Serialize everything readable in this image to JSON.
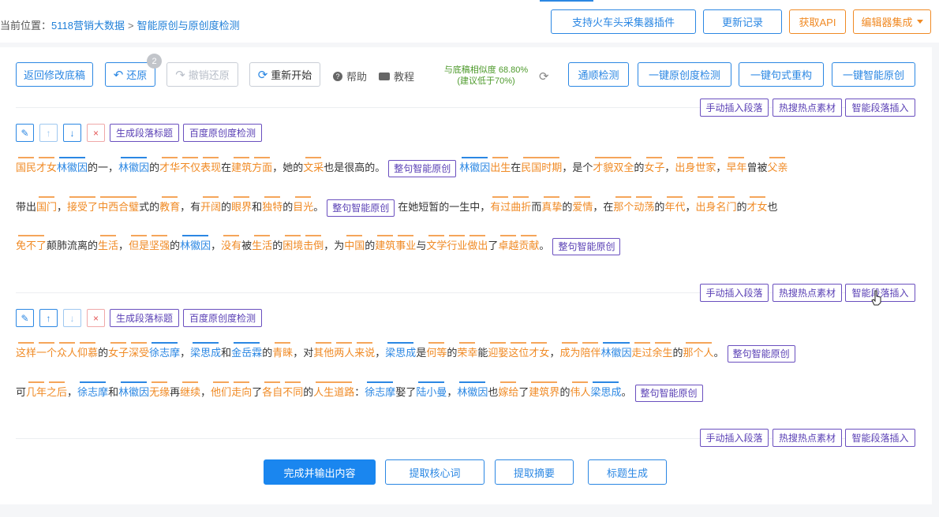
{
  "breadcrumb": {
    "prefix": "当前位置：",
    "items": [
      "5118营销大数据",
      "智能原创与原创度检测"
    ],
    "separator": ">"
  },
  "header_buttons": [
    "支持火车头采集器插件",
    "更新记录",
    "获取API",
    "编辑器集成"
  ],
  "toolbar": {
    "back": "返回修改底稿",
    "undo": "还原",
    "undo_count": "2",
    "redo": "撤销还原",
    "restart": "重新开始",
    "help": "帮助",
    "tutorial": "教程",
    "similarity_line1": "与底稿相似度 68.80%",
    "similarity_line2": "(建议低于70%)",
    "actions": [
      "通顺检测",
      "一键原创度检测",
      "一键句式重构",
      "一键智能原创"
    ]
  },
  "insert_buttons": [
    "手动插入段落",
    "热搜热点素材",
    "智能段落插入"
  ],
  "para_tools": {
    "edit": "✎",
    "up": "↑",
    "down": "↓",
    "delete": "×",
    "gen_title": "生成段落标题",
    "baidu_check": "百度原创度检测"
  },
  "sentence_button": "整句智能原创",
  "paragraph1": {
    "line1": [
      [
        "国民",
        "o"
      ],
      [
        "才女",
        "o"
      ],
      [
        "林徽因",
        "b"
      ],
      [
        "的一，",
        ""
      ],
      [
        "林徽因",
        "b"
      ],
      [
        "的",
        ""
      ],
      [
        "才华",
        "o"
      ],
      [
        "不仅",
        "o"
      ],
      [
        "表现",
        "o"
      ],
      [
        "在",
        ""
      ],
      [
        "建筑",
        "o"
      ],
      [
        "方面",
        "o"
      ],
      [
        "，她的",
        ""
      ],
      [
        "文采",
        "o"
      ],
      [
        "也是很高的。",
        ""
      ],
      [
        "#BTN#",
        ""
      ],
      [
        "林徽因",
        "b"
      ],
      [
        "出生",
        "o"
      ],
      [
        "在",
        ""
      ],
      [
        "民国时期",
        "o"
      ],
      [
        "，是个",
        ""
      ],
      [
        "才貌双全",
        "o"
      ],
      [
        "的",
        ""
      ],
      [
        "女子",
        "o"
      ],
      [
        "，",
        ""
      ],
      [
        "出身",
        "o"
      ],
      [
        "世家",
        "o"
      ],
      [
        "，",
        ""
      ],
      [
        "早年",
        "o"
      ],
      [
        "曾被",
        ""
      ],
      [
        "父亲",
        "o"
      ]
    ],
    "line2": [
      [
        "带出",
        ""
      ],
      [
        "国门",
        "o"
      ],
      [
        "，",
        ""
      ],
      [
        "接受了",
        "o"
      ],
      [
        "中西合璧",
        "o"
      ],
      [
        "式的",
        ""
      ],
      [
        "教育",
        "o"
      ],
      [
        "，有",
        ""
      ],
      [
        "开阔",
        "o"
      ],
      [
        "的",
        ""
      ],
      [
        "眼界",
        "o"
      ],
      [
        "和",
        ""
      ],
      [
        "独特",
        "o"
      ],
      [
        "的",
        ""
      ],
      [
        "目光",
        "o"
      ],
      [
        "。",
        ""
      ],
      [
        "#BTN#",
        ""
      ],
      [
        "在她短暂的一生中，",
        ""
      ],
      [
        "有过",
        "o"
      ],
      [
        "曲折",
        "o"
      ],
      [
        "而",
        ""
      ],
      [
        "真挚",
        "o"
      ],
      [
        "的",
        ""
      ],
      [
        "爱情",
        "o"
      ],
      [
        "，在",
        ""
      ],
      [
        "那个",
        "o"
      ],
      [
        "动荡",
        "o"
      ],
      [
        "的",
        ""
      ],
      [
        "年代",
        "o"
      ],
      [
        "，",
        ""
      ],
      [
        "出身",
        "o"
      ],
      [
        "名门",
        "o"
      ],
      [
        "的",
        ""
      ],
      [
        "才女",
        "o"
      ],
      [
        "也",
        ""
      ]
    ],
    "line3": [
      [
        "免不了",
        "o"
      ],
      [
        "颠肺流离的",
        ""
      ],
      [
        "生活",
        "o"
      ],
      [
        "，",
        ""
      ],
      [
        "但是",
        "o"
      ],
      [
        "坚强",
        "o"
      ],
      [
        "的",
        ""
      ],
      [
        "林徽因",
        "b"
      ],
      [
        "，",
        ""
      ],
      [
        "没有",
        "o"
      ],
      [
        "被",
        ""
      ],
      [
        "生活",
        "o"
      ],
      [
        "的",
        ""
      ],
      [
        "困境",
        "o"
      ],
      [
        "击倒",
        "o"
      ],
      [
        "，为",
        ""
      ],
      [
        "中国",
        "o"
      ],
      [
        "的",
        ""
      ],
      [
        "建筑",
        "o"
      ],
      [
        "事业",
        "o"
      ],
      [
        "与",
        ""
      ],
      [
        "文学",
        "o"
      ],
      [
        "行业",
        "o"
      ],
      [
        "做出",
        "o"
      ],
      [
        "了",
        ""
      ],
      [
        "卓越",
        "o"
      ],
      [
        "贡献",
        "o"
      ],
      [
        "。",
        ""
      ],
      [
        "#BTN#",
        ""
      ]
    ]
  },
  "paragraph2": {
    "line1": [
      [
        "这样",
        "o"
      ],
      [
        "一个",
        "o"
      ],
      [
        "众人",
        "o"
      ],
      [
        "仰慕",
        "o"
      ],
      [
        "的",
        ""
      ],
      [
        "女子",
        "o"
      ],
      [
        "深受",
        "o"
      ],
      [
        "徐志摩",
        "b"
      ],
      [
        "，",
        ""
      ],
      [
        "梁思成",
        "b"
      ],
      [
        "和",
        ""
      ],
      [
        "金岳霖",
        "b"
      ],
      [
        "的",
        ""
      ],
      [
        "青睐",
        "o"
      ],
      [
        "，对",
        ""
      ],
      [
        "其他",
        "o"
      ],
      [
        "两人",
        "o"
      ],
      [
        "来说",
        "o"
      ],
      [
        "，",
        ""
      ],
      [
        "梁思成",
        "b"
      ],
      [
        "是",
        ""
      ],
      [
        "何等",
        "o"
      ],
      [
        "的",
        ""
      ],
      [
        "荣幸",
        "o"
      ],
      [
        "能",
        ""
      ],
      [
        "迎娶",
        "o"
      ],
      [
        "这位",
        "o"
      ],
      [
        "才女",
        "o"
      ],
      [
        "，",
        ""
      ],
      [
        "成为",
        "o"
      ],
      [
        "陪伴",
        "o"
      ],
      [
        "林徽因",
        "b"
      ],
      [
        "走过",
        "o"
      ],
      [
        "余生",
        "o"
      ],
      [
        "的",
        ""
      ],
      [
        "那个人",
        "o"
      ],
      [
        "。",
        ""
      ],
      [
        "#BTN#",
        ""
      ]
    ],
    "line2": [
      [
        "可",
        ""
      ],
      [
        "几年",
        "o"
      ],
      [
        "之后",
        "o"
      ],
      [
        "，",
        ""
      ],
      [
        "徐志摩",
        "b"
      ],
      [
        "和",
        ""
      ],
      [
        "林徽因",
        "b"
      ],
      [
        "无缘",
        "o"
      ],
      [
        "再",
        ""
      ],
      [
        "继续",
        "o"
      ],
      [
        "，",
        ""
      ],
      [
        "他们",
        "o"
      ],
      [
        "走向",
        "o"
      ],
      [
        "了",
        ""
      ],
      [
        "各自",
        "o"
      ],
      [
        "不同",
        "o"
      ],
      [
        "的",
        ""
      ],
      [
        "人生道路",
        "o"
      ],
      [
        "：",
        ""
      ],
      [
        "徐志摩",
        "b"
      ],
      [
        "娶了",
        ""
      ],
      [
        "陆小曼",
        "b"
      ],
      [
        "，",
        ""
      ],
      [
        "林徽因",
        "b"
      ],
      [
        "也",
        ""
      ],
      [
        "嫁给",
        "o"
      ],
      [
        "了",
        ""
      ],
      [
        "建筑界",
        "o"
      ],
      [
        "的",
        ""
      ],
      [
        "伟人",
        "o"
      ],
      [
        "梁思成",
        "b"
      ],
      [
        "。",
        ""
      ],
      [
        "#BTN#",
        ""
      ]
    ]
  },
  "bottom_buttons": [
    "完成并输出内容",
    "提取核心词",
    "提取摘要",
    "标题生成"
  ]
}
